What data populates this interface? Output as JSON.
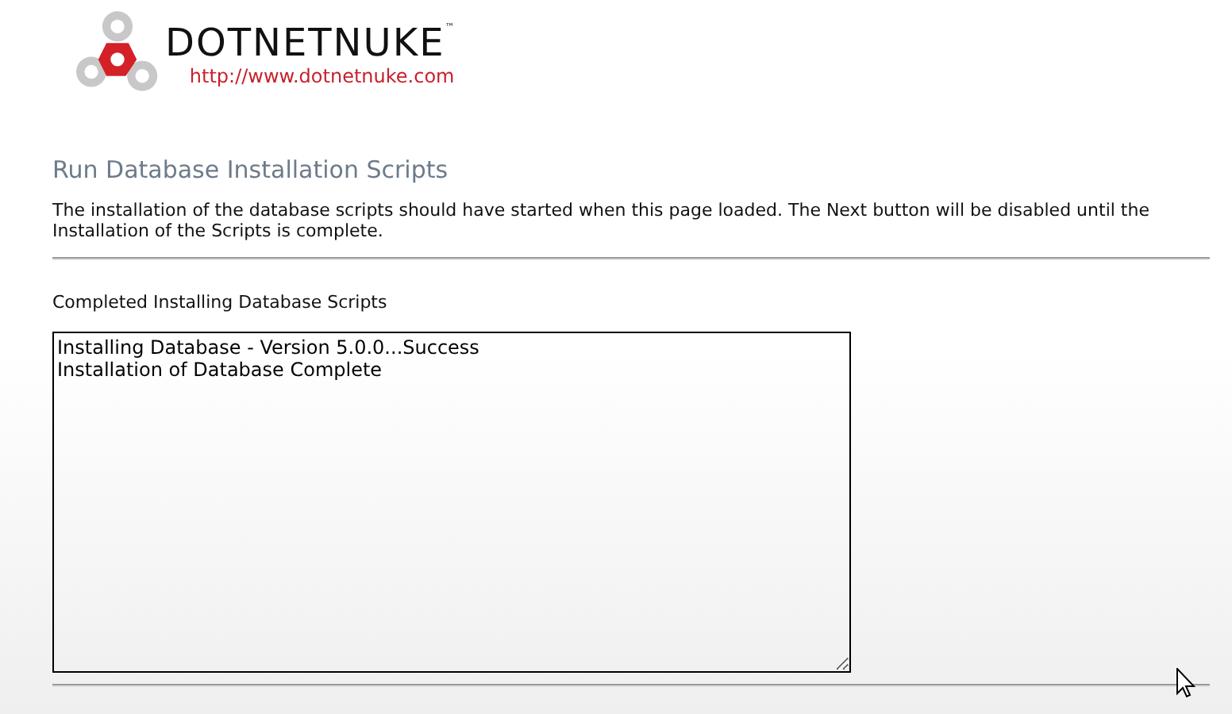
{
  "logo": {
    "name": "DOTNETNUKE",
    "trademark": "™",
    "url": "http://www.dotnetnuke.com"
  },
  "heading": "Run Database Installation Scripts",
  "description": "The installation of the database scripts should have started when this page loaded. The Next button will be disabled until the Installation of the Scripts is complete.",
  "status_label": "Completed Installing Database Scripts",
  "log": {
    "lines": [
      "Installing Database - Version 5.0.0...Success",
      "Installation of Database Complete"
    ]
  }
}
